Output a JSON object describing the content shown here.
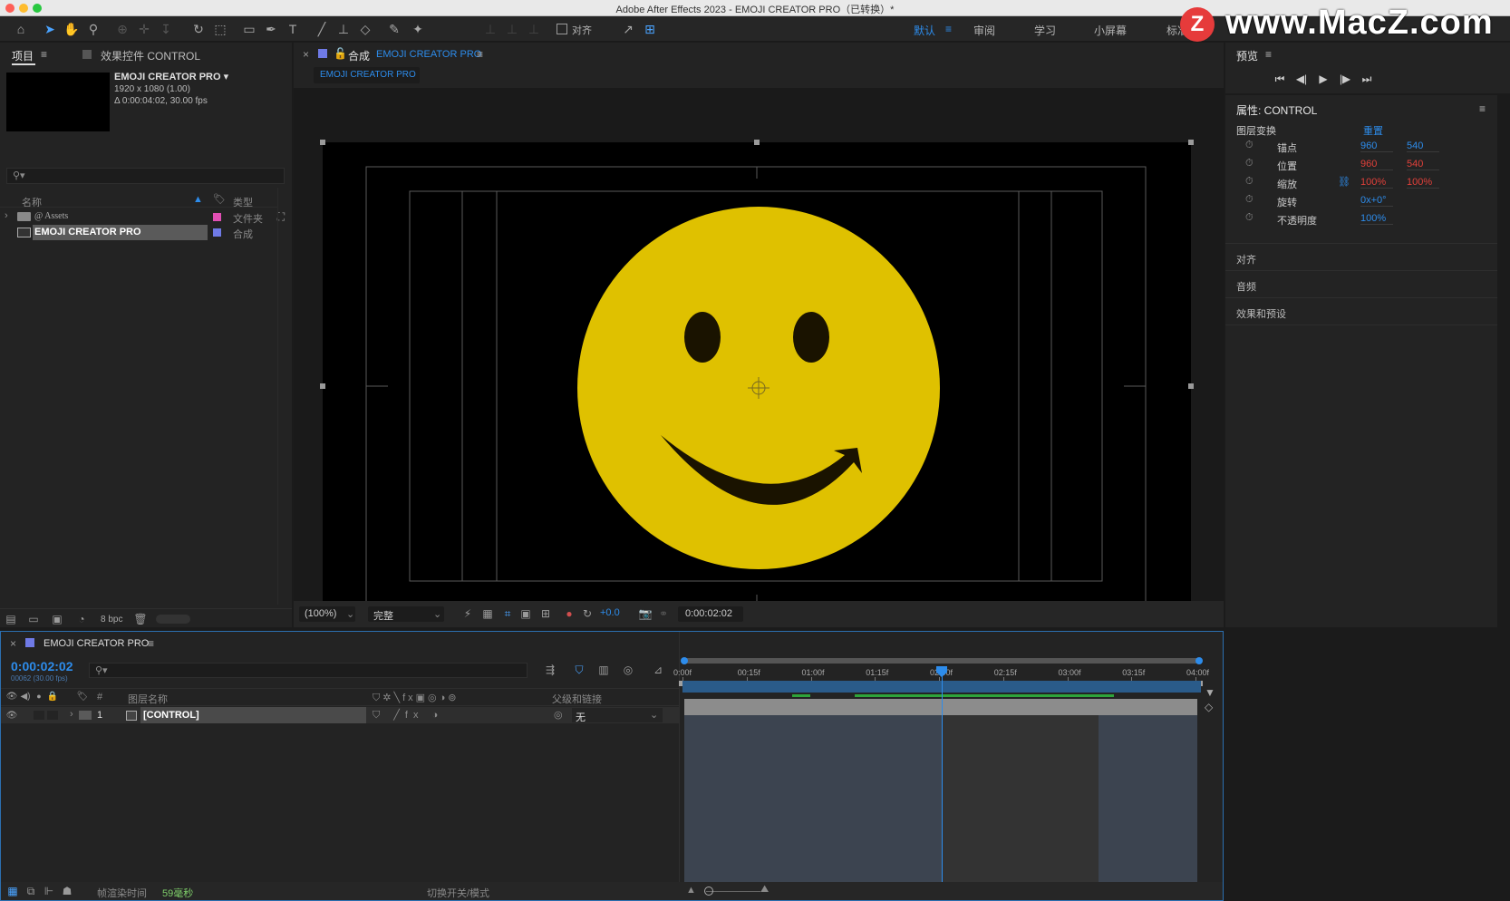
{
  "window": {
    "title": "Adobe After Effects 2023 - EMOJI CREATOR PRO（已转换）*"
  },
  "watermark": {
    "text": "www.MacZ.com",
    "logo": "Z"
  },
  "toolbar": {
    "align_label": "对齐",
    "workspaces": [
      "默认",
      "审阅",
      "学习",
      "小屏幕",
      "标准"
    ]
  },
  "project": {
    "tab_project": "项目",
    "tab_effects": "效果控件 CONTROL",
    "comp_name": "EMOJI CREATOR PRO ▾",
    "comp_size": "1920 x 1080 (1.00)",
    "comp_duration": "Δ 0:00:04:02, 30.00 fps",
    "col_name": "名称",
    "col_type": "类型",
    "items": [
      {
        "name": "@ Assets",
        "type": "文件夹",
        "color": "#e14fb4"
      },
      {
        "name": "EMOJI CREATOR PRO",
        "type": "合成",
        "color": "#6f7ae6"
      }
    ],
    "bpc": "8 bpc"
  },
  "composition": {
    "tab_prefix": "合成",
    "tab_name": "EMOJI CREATOR PRO",
    "subtab": "EMOJI CREATOR PRO",
    "zoom": "(100%)",
    "quality": "完整",
    "exposure": "+0.0",
    "timecode": "0:00:02:02",
    "face_color": "#dfc100"
  },
  "preview": {
    "title": "预览"
  },
  "properties": {
    "title": "属性: CONTROL",
    "section": "图层变换",
    "reset": "重置",
    "rows": [
      {
        "label": "锚点",
        "v1": "960",
        "v2": "540",
        "c1": "#2d8ceb",
        "c2": "#2d8ceb"
      },
      {
        "label": "位置",
        "v1": "960",
        "v2": "540",
        "c1": "#e0403a",
        "c2": "#e0403a"
      },
      {
        "label": "缩放",
        "v1": "100%",
        "v2": "100%",
        "c1": "#e0403a",
        "c2": "#e0403a"
      },
      {
        "label": "旋转",
        "v1": "0x+0°",
        "v2": "",
        "c1": "#2d8ceb",
        "c2": "#2d8ceb"
      },
      {
        "label": "不透明度",
        "v1": "100%",
        "v2": "",
        "c1": "#2d8ceb",
        "c2": "#2d8ceb"
      }
    ],
    "collapsed": [
      "对齐",
      "音频",
      "效果和预设"
    ]
  },
  "timeline": {
    "tab_name": "EMOJI CREATOR PRO",
    "timecode": "0:00:02:02",
    "fps_note": "00062 (30.00 fps)",
    "col_layer_name": "图层名称",
    "col_parent": "父级和链接",
    "col_num": "#",
    "layer": {
      "num": "1",
      "name": "[CONTROL]",
      "parent": "无"
    },
    "ruler": [
      "0:00f",
      "00:15f",
      "01:00f",
      "01:15f",
      "02:00f",
      "02:15f",
      "03:00f",
      "03:15f",
      "04:00f"
    ],
    "render_label": "帧渲染时间",
    "render_value": "59毫秒",
    "toggle_label": "切换开关/模式"
  }
}
